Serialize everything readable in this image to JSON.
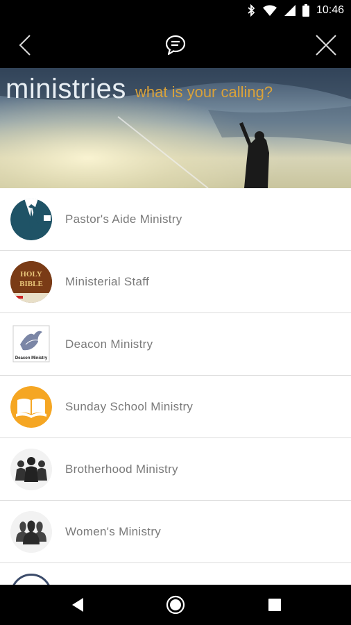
{
  "status_bar": {
    "time": "10:46",
    "icons": [
      "bluetooth-icon",
      "wifi-icon",
      "cell-signal-icon",
      "battery-icon"
    ]
  },
  "app_bar": {
    "back_icon": "chevron-left-icon",
    "chat_icon": "chat-bubble-icon",
    "close_icon": "close-icon"
  },
  "hero": {
    "title": "ministries",
    "subtitle": "what is your calling?"
  },
  "ministries": [
    {
      "label": "Pastor's Aide Ministry",
      "icon": "suit-icon"
    },
    {
      "label": "Ministerial Staff",
      "icon": "holy-bible-icon",
      "icon_text": [
        "HOLY",
        "BIBLE"
      ]
    },
    {
      "label": "Deacon Ministry",
      "icon": "dove-icon",
      "icon_text": [
        "Deacon Ministry"
      ]
    },
    {
      "label": "Sunday School Ministry",
      "icon": "open-book-icon"
    },
    {
      "label": "Brotherhood Ministry",
      "icon": "group-men-icon"
    },
    {
      "label": "Women's Ministry",
      "icon": "group-women-icon"
    }
  ],
  "nav_bar": {
    "back": "triangle-back-icon",
    "home": "circle-home-icon",
    "recents": "square-recents-icon"
  },
  "colors": {
    "accent": "#d9a23a",
    "suit": "#1f5366",
    "sunday_school": "#f5a623"
  }
}
